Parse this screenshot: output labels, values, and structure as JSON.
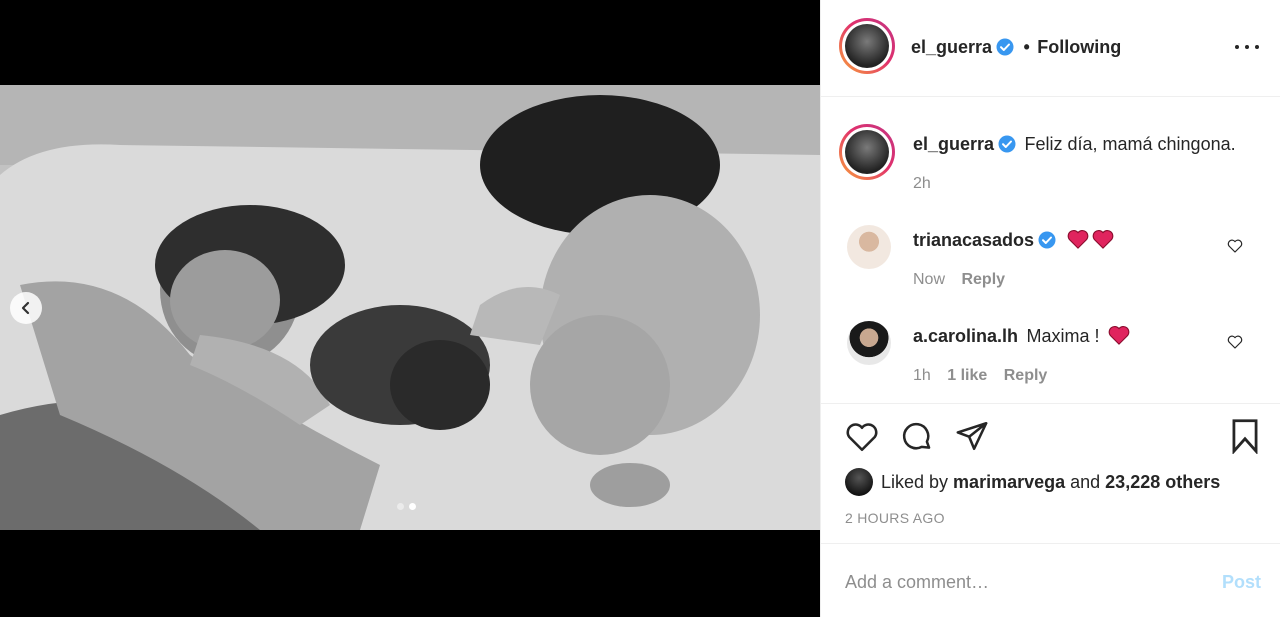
{
  "post": {
    "author": "el_guerra",
    "follow_sep": "•",
    "follow_status": "Following",
    "caption": "Feliz día, mamá chingona.",
    "caption_time": "2h"
  },
  "comments": [
    {
      "user": "trianacasados",
      "verified": true,
      "text": "",
      "hearts": 2,
      "time": "Now",
      "likes": "",
      "reply": "Reply"
    },
    {
      "user": "a.carolina.lh",
      "verified": false,
      "text": "Maxima !",
      "hearts": 1,
      "time": "1h",
      "likes": "1 like",
      "reply": "Reply"
    }
  ],
  "likes": {
    "prefix": "Liked by",
    "user": "marimarvega",
    "mid": "and",
    "others": "23,228 others"
  },
  "timestamp": "2 HOURS AGO",
  "add_comment": {
    "placeholder": "Add a comment…",
    "post_label": "Post"
  },
  "carousel": {
    "count": 2,
    "active": 2
  },
  "colors": {
    "verified": "#3897f0",
    "heart": "#ed4956",
    "post_disabled": "#b2dffc",
    "meta": "#8e8e8e"
  },
  "icons": [
    "chevron-left-icon",
    "more-icon",
    "verified-icon",
    "heart-icon",
    "comment-icon",
    "share-icon",
    "bookmark-icon"
  ]
}
